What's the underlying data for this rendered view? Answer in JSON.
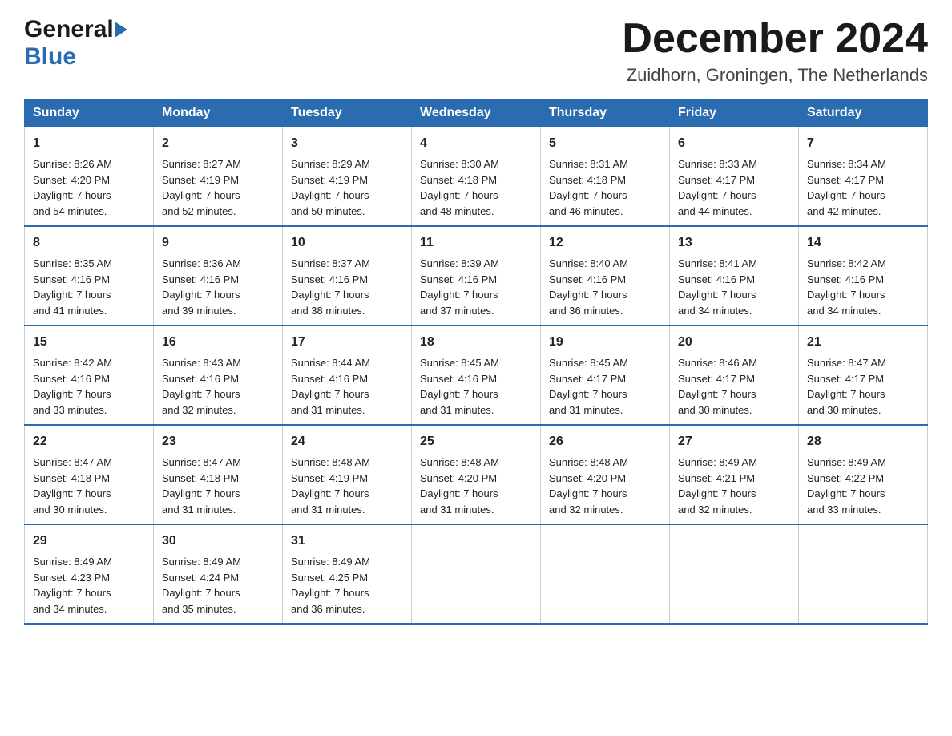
{
  "header": {
    "logo_general": "General",
    "logo_blue": "Blue",
    "main_title": "December 2024",
    "subtitle": "Zuidhorn, Groningen, The Netherlands"
  },
  "days_of_week": [
    "Sunday",
    "Monday",
    "Tuesday",
    "Wednesday",
    "Thursday",
    "Friday",
    "Saturday"
  ],
  "weeks": [
    [
      {
        "day": "1",
        "info": "Sunrise: 8:26 AM\nSunset: 4:20 PM\nDaylight: 7 hours\nand 54 minutes."
      },
      {
        "day": "2",
        "info": "Sunrise: 8:27 AM\nSunset: 4:19 PM\nDaylight: 7 hours\nand 52 minutes."
      },
      {
        "day": "3",
        "info": "Sunrise: 8:29 AM\nSunset: 4:19 PM\nDaylight: 7 hours\nand 50 minutes."
      },
      {
        "day": "4",
        "info": "Sunrise: 8:30 AM\nSunset: 4:18 PM\nDaylight: 7 hours\nand 48 minutes."
      },
      {
        "day": "5",
        "info": "Sunrise: 8:31 AM\nSunset: 4:18 PM\nDaylight: 7 hours\nand 46 minutes."
      },
      {
        "day": "6",
        "info": "Sunrise: 8:33 AM\nSunset: 4:17 PM\nDaylight: 7 hours\nand 44 minutes."
      },
      {
        "day": "7",
        "info": "Sunrise: 8:34 AM\nSunset: 4:17 PM\nDaylight: 7 hours\nand 42 minutes."
      }
    ],
    [
      {
        "day": "8",
        "info": "Sunrise: 8:35 AM\nSunset: 4:16 PM\nDaylight: 7 hours\nand 41 minutes."
      },
      {
        "day": "9",
        "info": "Sunrise: 8:36 AM\nSunset: 4:16 PM\nDaylight: 7 hours\nand 39 minutes."
      },
      {
        "day": "10",
        "info": "Sunrise: 8:37 AM\nSunset: 4:16 PM\nDaylight: 7 hours\nand 38 minutes."
      },
      {
        "day": "11",
        "info": "Sunrise: 8:39 AM\nSunset: 4:16 PM\nDaylight: 7 hours\nand 37 minutes."
      },
      {
        "day": "12",
        "info": "Sunrise: 8:40 AM\nSunset: 4:16 PM\nDaylight: 7 hours\nand 36 minutes."
      },
      {
        "day": "13",
        "info": "Sunrise: 8:41 AM\nSunset: 4:16 PM\nDaylight: 7 hours\nand 34 minutes."
      },
      {
        "day": "14",
        "info": "Sunrise: 8:42 AM\nSunset: 4:16 PM\nDaylight: 7 hours\nand 34 minutes."
      }
    ],
    [
      {
        "day": "15",
        "info": "Sunrise: 8:42 AM\nSunset: 4:16 PM\nDaylight: 7 hours\nand 33 minutes."
      },
      {
        "day": "16",
        "info": "Sunrise: 8:43 AM\nSunset: 4:16 PM\nDaylight: 7 hours\nand 32 minutes."
      },
      {
        "day": "17",
        "info": "Sunrise: 8:44 AM\nSunset: 4:16 PM\nDaylight: 7 hours\nand 31 minutes."
      },
      {
        "day": "18",
        "info": "Sunrise: 8:45 AM\nSunset: 4:16 PM\nDaylight: 7 hours\nand 31 minutes."
      },
      {
        "day": "19",
        "info": "Sunrise: 8:45 AM\nSunset: 4:17 PM\nDaylight: 7 hours\nand 31 minutes."
      },
      {
        "day": "20",
        "info": "Sunrise: 8:46 AM\nSunset: 4:17 PM\nDaylight: 7 hours\nand 30 minutes."
      },
      {
        "day": "21",
        "info": "Sunrise: 8:47 AM\nSunset: 4:17 PM\nDaylight: 7 hours\nand 30 minutes."
      }
    ],
    [
      {
        "day": "22",
        "info": "Sunrise: 8:47 AM\nSunset: 4:18 PM\nDaylight: 7 hours\nand 30 minutes."
      },
      {
        "day": "23",
        "info": "Sunrise: 8:47 AM\nSunset: 4:18 PM\nDaylight: 7 hours\nand 31 minutes."
      },
      {
        "day": "24",
        "info": "Sunrise: 8:48 AM\nSunset: 4:19 PM\nDaylight: 7 hours\nand 31 minutes."
      },
      {
        "day": "25",
        "info": "Sunrise: 8:48 AM\nSunset: 4:20 PM\nDaylight: 7 hours\nand 31 minutes."
      },
      {
        "day": "26",
        "info": "Sunrise: 8:48 AM\nSunset: 4:20 PM\nDaylight: 7 hours\nand 32 minutes."
      },
      {
        "day": "27",
        "info": "Sunrise: 8:49 AM\nSunset: 4:21 PM\nDaylight: 7 hours\nand 32 minutes."
      },
      {
        "day": "28",
        "info": "Sunrise: 8:49 AM\nSunset: 4:22 PM\nDaylight: 7 hours\nand 33 minutes."
      }
    ],
    [
      {
        "day": "29",
        "info": "Sunrise: 8:49 AM\nSunset: 4:23 PM\nDaylight: 7 hours\nand 34 minutes."
      },
      {
        "day": "30",
        "info": "Sunrise: 8:49 AM\nSunset: 4:24 PM\nDaylight: 7 hours\nand 35 minutes."
      },
      {
        "day": "31",
        "info": "Sunrise: 8:49 AM\nSunset: 4:25 PM\nDaylight: 7 hours\nand 36 minutes."
      },
      {
        "day": "",
        "info": ""
      },
      {
        "day": "",
        "info": ""
      },
      {
        "day": "",
        "info": ""
      },
      {
        "day": "",
        "info": ""
      }
    ]
  ]
}
